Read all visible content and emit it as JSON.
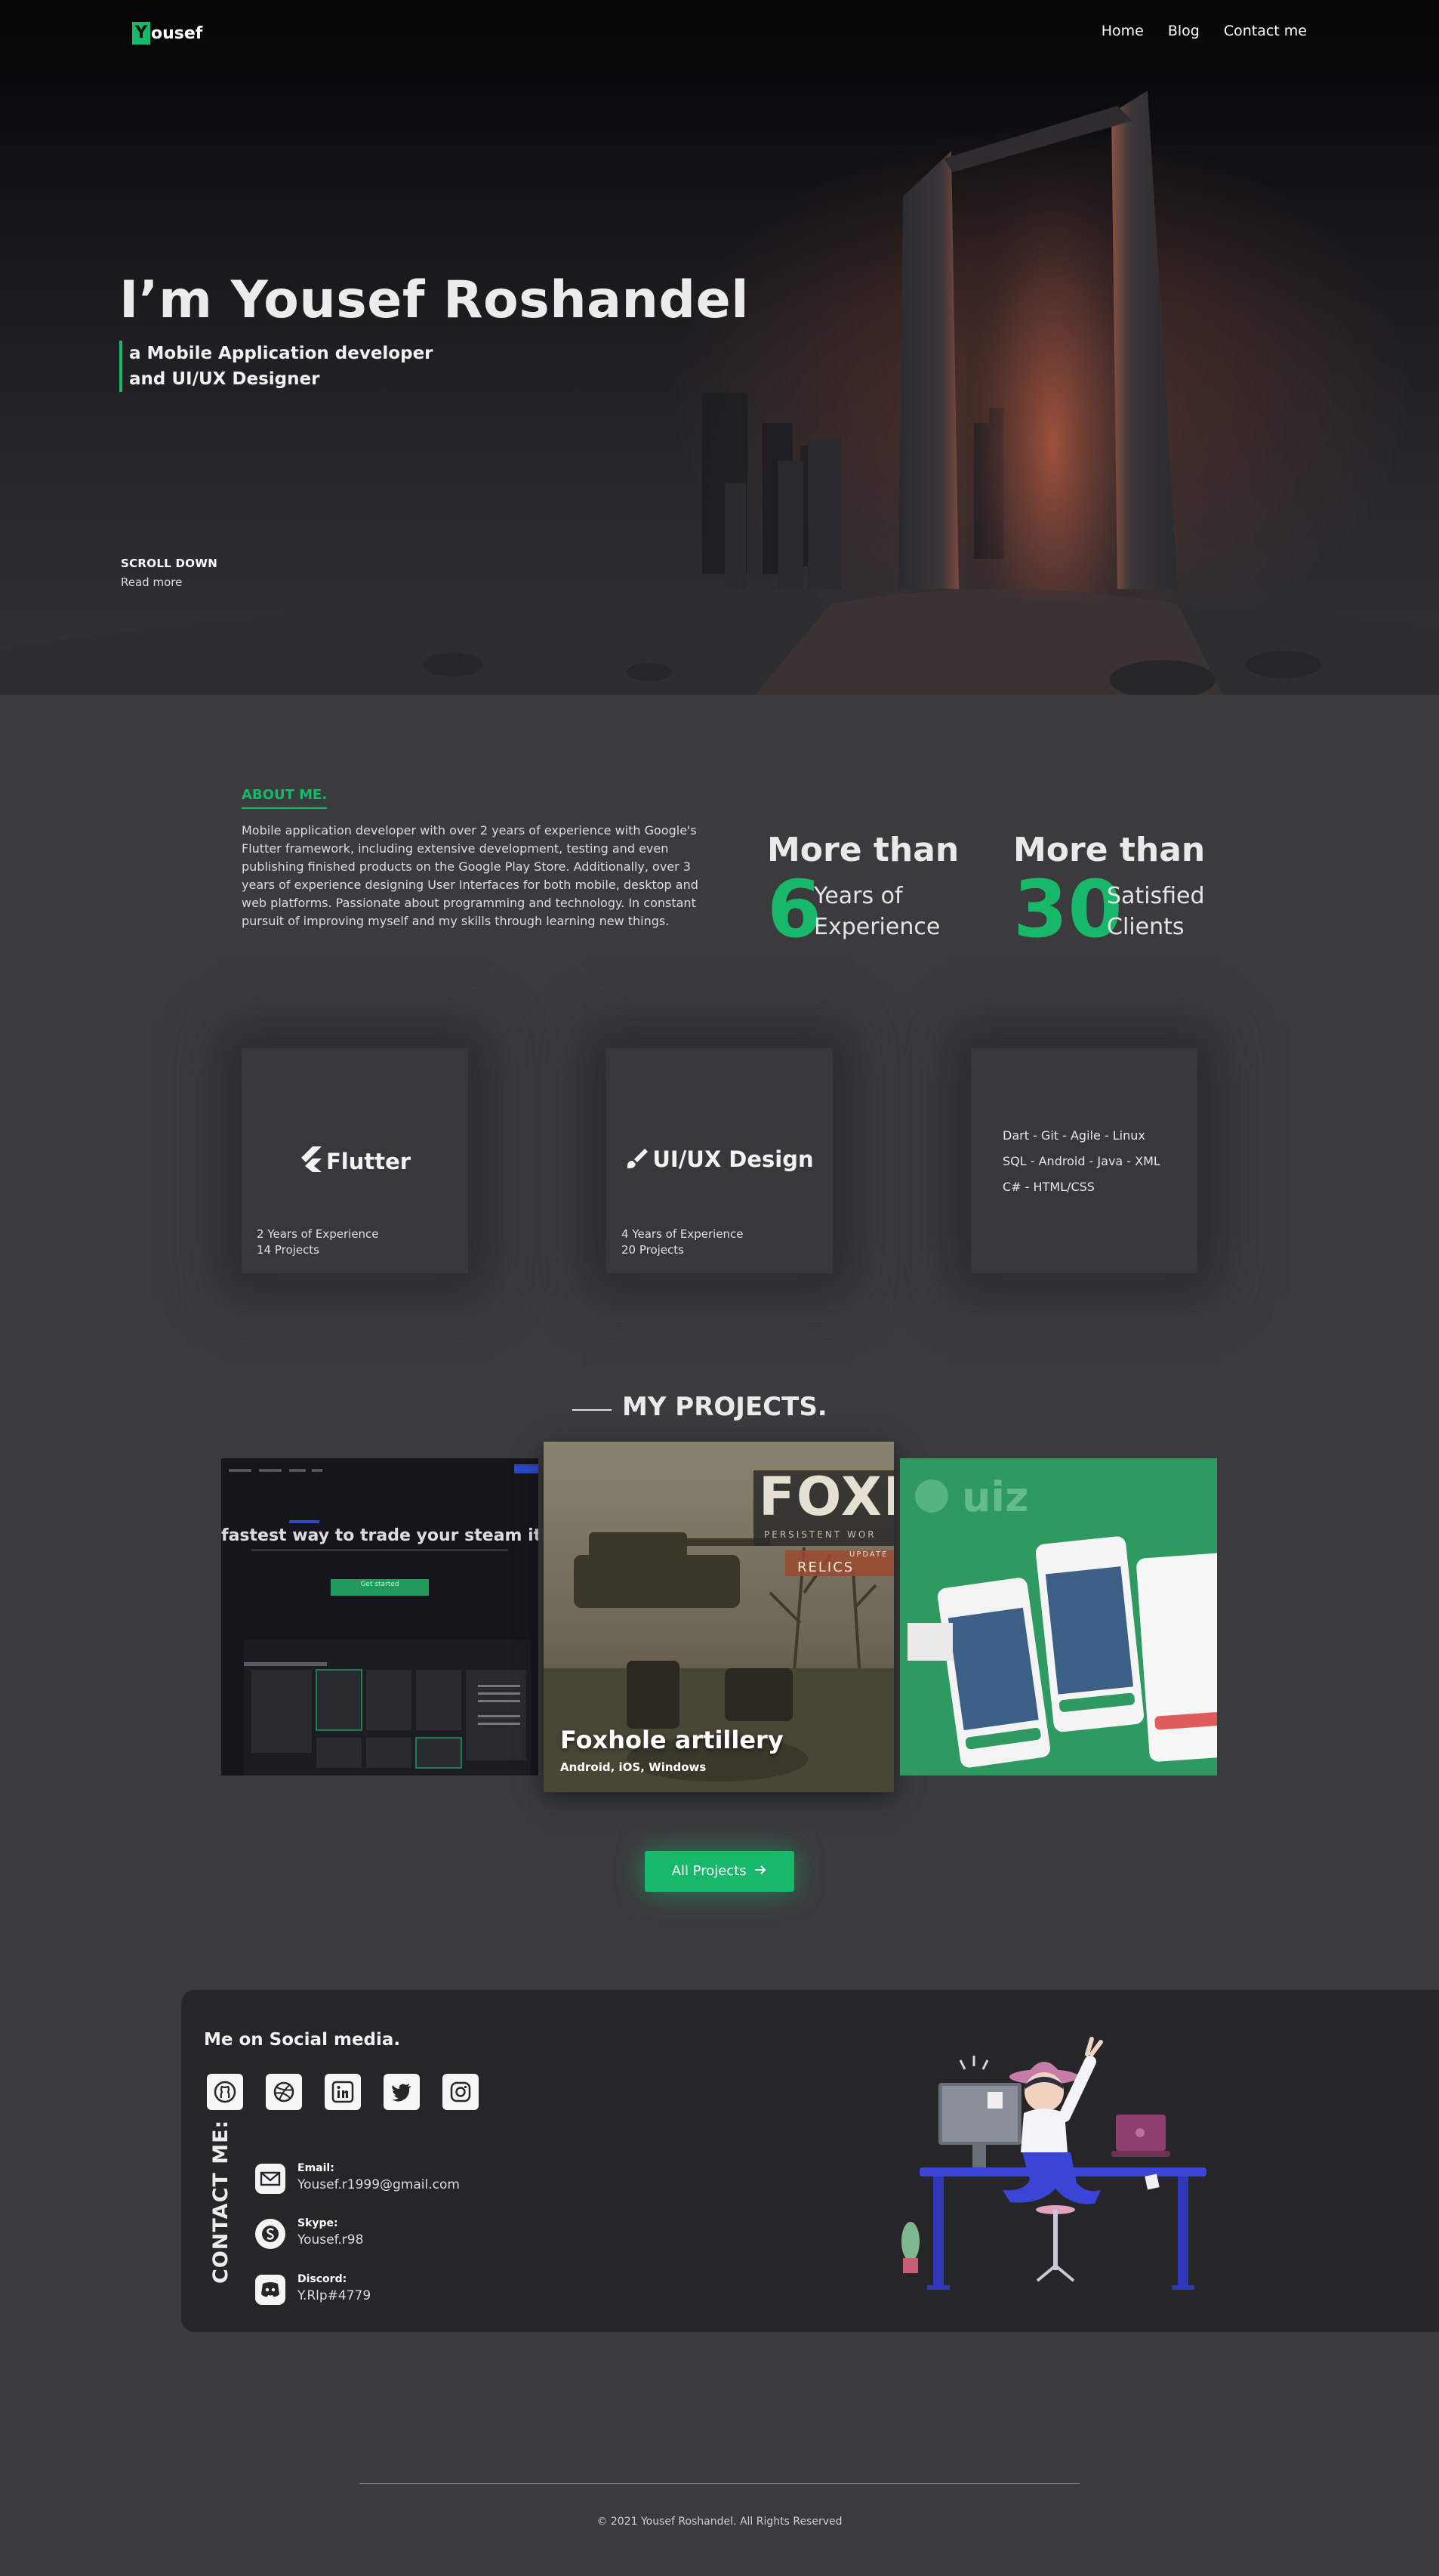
{
  "logo": {
    "mark": "Y",
    "rest": "ousef"
  },
  "nav": {
    "items": [
      "Home",
      "Blog",
      "Contact me"
    ]
  },
  "hero": {
    "title": "I’m Yousef Roshandel",
    "subtitle_line1": "a Mobile Application developer",
    "subtitle_line2": "and UI/UX Designer",
    "scroll_down": "SCROLL DOWN",
    "read_more": "Read more"
  },
  "about": {
    "label": "ABOUT ME.",
    "text": "Mobile application developer with over 2 years of experience with Google's Flutter framework, including extensive development, testing and even publishing finished products on the Google Play Store. Additionally, over 3 years of experience designing User Interfaces for both mobile, desktop and web platforms. Passionate about programming and technology. In constant pursuit of improving myself and my skills through learning new things."
  },
  "stats": [
    {
      "prefix": "More than",
      "number": "6",
      "line1": "Years of",
      "line2": "Experience"
    },
    {
      "prefix": "More than",
      "number": "30",
      "line1": "Satisfied",
      "line2": "Clients"
    }
  ],
  "skills": [
    {
      "title": "Flutter",
      "icon": "flutter-icon",
      "line1": "2 Years of Experience",
      "line2": "14 Projects"
    },
    {
      "title": "UI/UX Design",
      "icon": "design-brush-icon",
      "line1": "4 Years of Experience",
      "line2": "20 Projects"
    },
    {
      "lines": [
        "Dart - Git - Agile - Linux",
        "SQL - Android - Java - XML",
        "C# - HTML/CSS"
      ]
    }
  ],
  "projects": {
    "title": "MY PROJECTS.",
    "items": [
      {
        "headline": "fastest way to trade your steam items",
        "button": "Get started"
      },
      {
        "name": "Foxhole artillery",
        "platforms": "Android, iOS, Windows",
        "art_text": "FOXH",
        "art_sub": "PERSISTENT WOR",
        "art_update": "UPDATE",
        "art_relics": "RELICS"
      },
      {
        "logo": "uiz"
      }
    ],
    "all_button": "All Projects"
  },
  "contact": {
    "social_title": "Me on Social media.",
    "social_icons": [
      "github-icon",
      "dribbble-icon",
      "linkedin-icon",
      "twitter-icon",
      "instagram-icon"
    ],
    "vertical_title": "CONTACT ME:",
    "items": [
      {
        "label": "Email:",
        "value": "Yousef.r1999@gmail.com",
        "icon": "mail-icon"
      },
      {
        "label": "Skype:",
        "value": "Yousef.r98",
        "icon": "skype-icon"
      },
      {
        "label": "Discord:",
        "value": "Y.Rlp#4779",
        "icon": "discord-icon"
      }
    ]
  },
  "footer": {
    "copyright": "© 2021 Yousef Roshandel. All Rights Reserved"
  },
  "colors": {
    "accent": "#17b86a",
    "background": "#3b3b3d",
    "panel": "#262628"
  }
}
